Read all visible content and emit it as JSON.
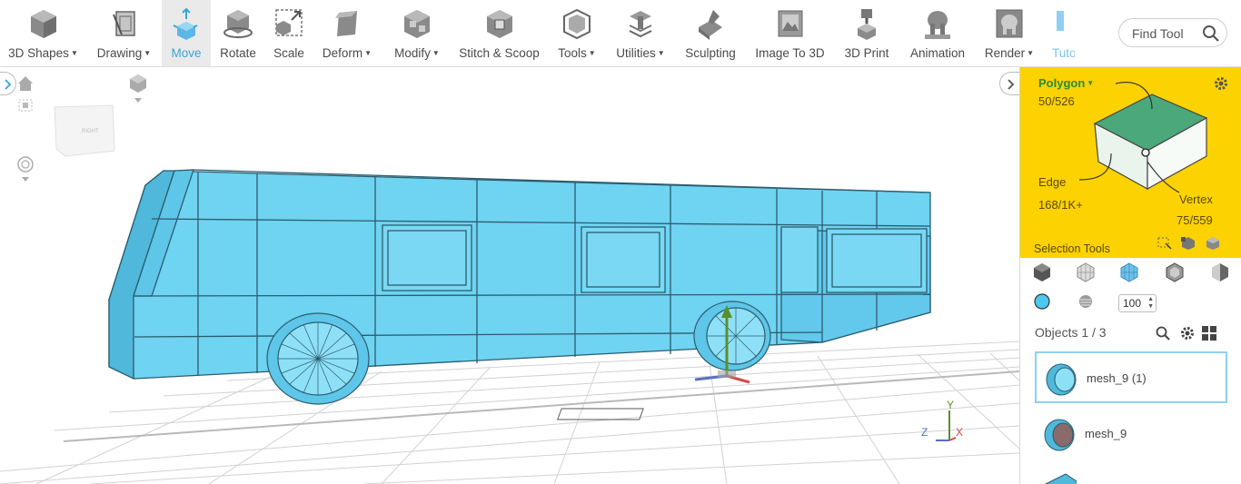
{
  "toolbar": {
    "items": [
      {
        "label": "3D Shapes",
        "dropdown": true,
        "icon": "cube-icon"
      },
      {
        "label": "Drawing",
        "dropdown": true,
        "icon": "drawing-icon"
      },
      {
        "label": "Move",
        "dropdown": false,
        "icon": "move-icon",
        "active": true
      },
      {
        "label": "Rotate",
        "dropdown": false,
        "icon": "rotate-icon"
      },
      {
        "label": "Scale",
        "dropdown": false,
        "icon": "scale-icon"
      },
      {
        "label": "Deform",
        "dropdown": true,
        "icon": "deform-icon"
      },
      {
        "label": "Modify",
        "dropdown": true,
        "icon": "modify-icon"
      },
      {
        "label": "Stitch & Scoop",
        "dropdown": false,
        "icon": "stitch-scoop-icon"
      },
      {
        "label": "Tools",
        "dropdown": true,
        "icon": "tools-icon"
      },
      {
        "label": "Utilities",
        "dropdown": true,
        "icon": "utilities-icon"
      },
      {
        "label": "Sculpting",
        "dropdown": false,
        "icon": "sculpting-icon"
      },
      {
        "label": "Image To 3D",
        "dropdown": false,
        "icon": "image-to-3d-icon"
      },
      {
        "label": "3D Print",
        "dropdown": false,
        "icon": "3d-print-icon"
      },
      {
        "label": "Animation",
        "dropdown": false,
        "icon": "animation-icon"
      },
      {
        "label": "Render",
        "dropdown": true,
        "icon": "render-icon"
      },
      {
        "label": "Tuto",
        "dropdown": false,
        "icon": "tutorials-icon"
      }
    ],
    "find_tool_placeholder": "Find Tool"
  },
  "viewport": {
    "view_cube_label": "RIGHT",
    "axis_labels": {
      "x": "X",
      "y": "Y",
      "z": "Z"
    }
  },
  "selection_panel": {
    "mode": "Polygon",
    "polygon_count": "50/526",
    "edge_label": "Edge",
    "edge_count": "168/1K+",
    "vertex_label": "Vertex",
    "vertex_count": "75/559",
    "tools_label": "Selection Tools"
  },
  "display": {
    "zoom_value": "100"
  },
  "objects": {
    "label": "Objects 1 / 3",
    "items": [
      {
        "name": "mesh_9 (1)",
        "selected": true
      },
      {
        "name": "mesh_9",
        "selected": false
      }
    ]
  },
  "colors": {
    "accent": "#3aa3d8",
    "selection_panel_bg": "#fcd200",
    "mesh": "#6fd3f2",
    "mesh_edge": "#2b5d6e"
  }
}
